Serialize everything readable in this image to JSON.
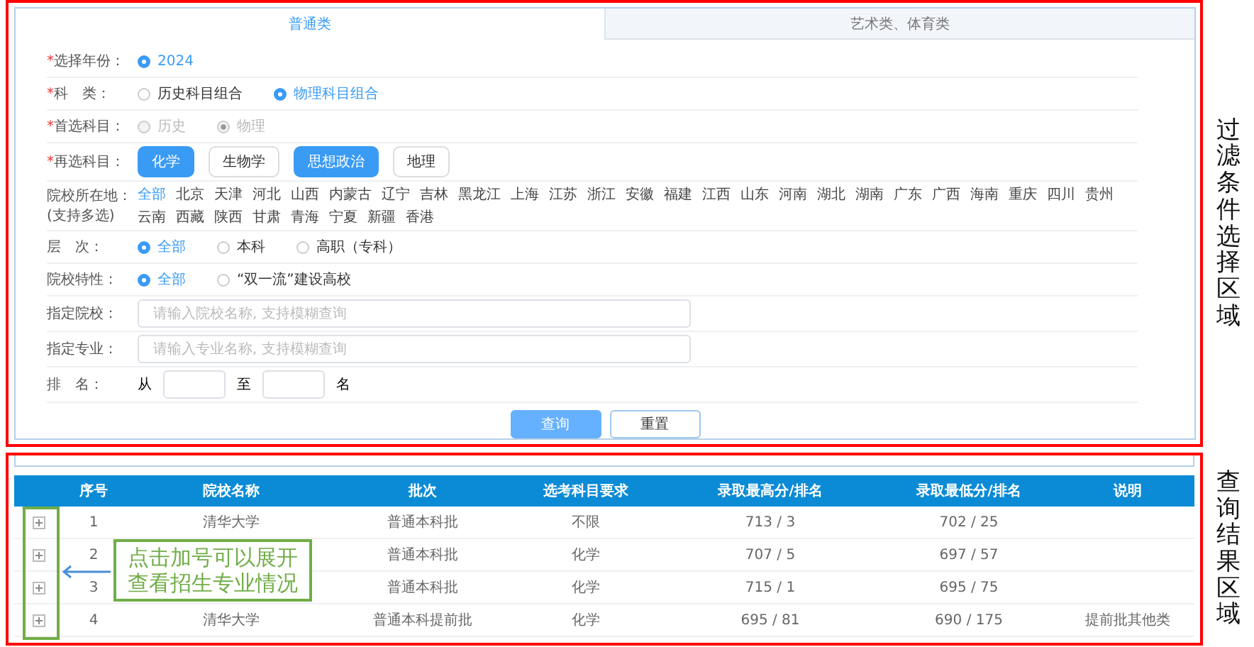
{
  "tabs": [
    {
      "label": "普通类",
      "selected": true
    },
    {
      "label": "艺术类、体育类",
      "selected": false
    }
  ],
  "form_rows": [
    {
      "kind": "radio",
      "required_mark": "*",
      "label": "选择年份：",
      "options": [
        {
          "label": "2024",
          "selected": true
        }
      ]
    },
    {
      "kind": "radio",
      "required_mark": "*",
      "label": "科　类：",
      "options": [
        {
          "label": "历史科目组合",
          "selected": false
        },
        {
          "label": "物理科目组合",
          "selected": true
        }
      ]
    },
    {
      "kind": "radio",
      "required_mark": "*",
      "label": "首选科目：",
      "disabled": true,
      "options": [
        {
          "label": "历史",
          "selected": false
        },
        {
          "label": "物理",
          "selected": true
        }
      ]
    },
    {
      "kind": "chips",
      "required_mark": "*",
      "label": "再选科目：",
      "options": [
        {
          "label": "化学",
          "selected": true
        },
        {
          "label": "生物学",
          "selected": false
        },
        {
          "label": "思想政治",
          "selected": true
        },
        {
          "label": "地理",
          "selected": false
        }
      ]
    },
    {
      "kind": "links",
      "label": "院校所在地：",
      "note": "(支持多选)",
      "options": [
        {
          "label": "全部",
          "selected": true
        },
        {
          "label": "北京",
          "selected": false
        },
        {
          "label": "天津",
          "selected": false
        },
        {
          "label": "河北",
          "selected": false
        },
        {
          "label": "山西",
          "selected": false
        },
        {
          "label": "内蒙古",
          "selected": false
        },
        {
          "label": "辽宁",
          "selected": false
        },
        {
          "label": "吉林",
          "selected": false
        },
        {
          "label": "黑龙江",
          "selected": false
        },
        {
          "label": "上海",
          "selected": false
        },
        {
          "label": "江苏",
          "selected": false
        },
        {
          "label": "浙江",
          "selected": false
        },
        {
          "label": "安徽",
          "selected": false
        },
        {
          "label": "福建",
          "selected": false
        },
        {
          "label": "江西",
          "selected": false
        },
        {
          "label": "山东",
          "selected": false
        },
        {
          "label": "河南",
          "selected": false
        },
        {
          "label": "湖北",
          "selected": false
        },
        {
          "label": "湖南",
          "selected": false
        },
        {
          "label": "广东",
          "selected": false
        },
        {
          "label": "广西",
          "selected": false
        },
        {
          "label": "海南",
          "selected": false
        },
        {
          "label": "重庆",
          "selected": false
        },
        {
          "label": "四川",
          "selected": false
        },
        {
          "label": "贵州",
          "selected": false
        },
        {
          "label": "云南",
          "selected": false
        },
        {
          "label": "西藏",
          "selected": false
        },
        {
          "label": "陕西",
          "selected": false
        },
        {
          "label": "甘肃",
          "selected": false
        },
        {
          "label": "青海",
          "selected": false
        },
        {
          "label": "宁夏",
          "selected": false
        },
        {
          "label": "新疆",
          "selected": false
        },
        {
          "label": "香港",
          "selected": false
        }
      ]
    },
    {
      "kind": "radio",
      "label": "层　次：",
      "options": [
        {
          "label": "全部",
          "selected": true
        },
        {
          "label": "本科",
          "selected": false
        },
        {
          "label": "高职（专科）",
          "selected": false
        }
      ]
    },
    {
      "kind": "radio",
      "label": "院校特性：",
      "options": [
        {
          "label": "全部",
          "selected": true
        },
        {
          "label": "“双一流”建设高校",
          "selected": false
        }
      ]
    },
    {
      "kind": "input",
      "label": "指定院校：",
      "placeholder": "请输入院校名称, 支持模糊查询"
    },
    {
      "kind": "input",
      "label": "指定专业：",
      "placeholder": "请输入专业名称, 支持模糊查询"
    },
    {
      "kind": "range",
      "label": "排　名：",
      "from": "从",
      "to": "至",
      "unit": "名"
    }
  ],
  "buttons": [
    {
      "label": "查询",
      "kind": "primary"
    },
    {
      "label": "重置",
      "kind": "default"
    }
  ],
  "table": {
    "columns": [
      "序号",
      "院校名称",
      "批次",
      "选考科目要求",
      "录取最高分/排名",
      "录取最低分/排名",
      "说明"
    ],
    "rows": [
      {
        "index": "1",
        "school": "清华大学",
        "batch": "普通本科批",
        "subjects": "不限",
        "max": "713 / 3",
        "min": "702 / 25"
      },
      {
        "index": "2",
        "batch": "普通本科批",
        "subjects": "化学",
        "max": "707 / 5",
        "min": "697 / 57"
      },
      {
        "index": "3",
        "batch": "普通本科批",
        "subjects": "化学",
        "max": "715 / 1",
        "min": "695 / 75"
      },
      {
        "index": "4",
        "school": "清华大学",
        "batch": "普通本科提前批",
        "subjects": "化学",
        "max": "695 / 81",
        "min": "690 / 175",
        "note": "提前批其他类"
      }
    ]
  },
  "annotations": {
    "filter_region_label": "过滤条件选择区域",
    "result_region_label": "查询结果区域",
    "callout": "点击加号可以展开查看招生专业情况"
  }
}
